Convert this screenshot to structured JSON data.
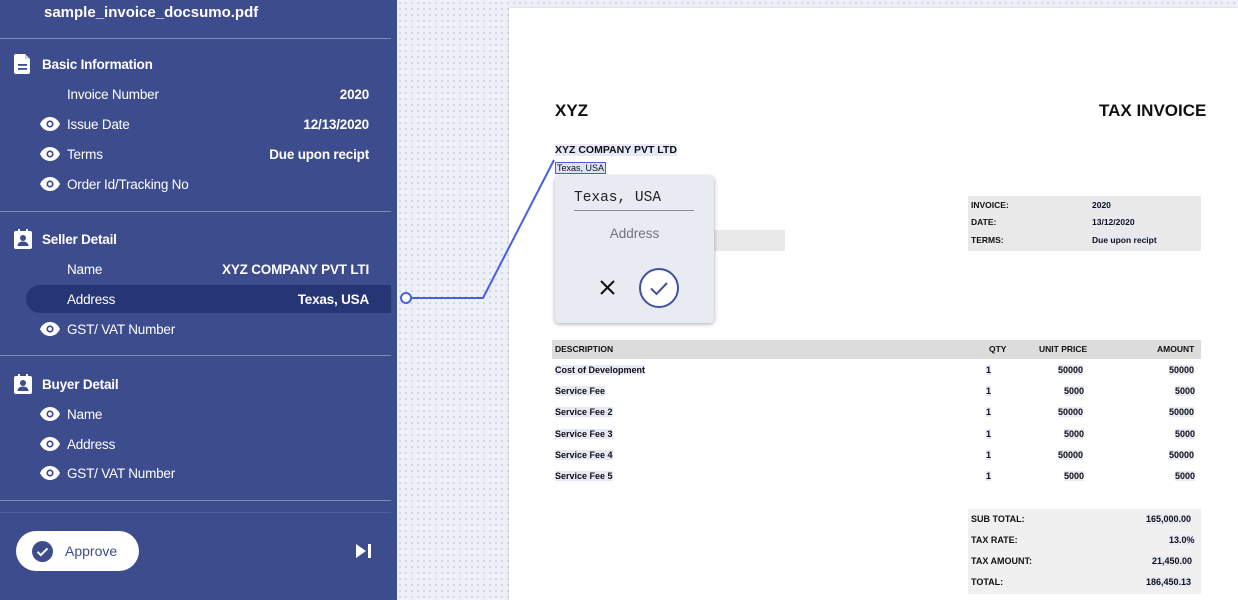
{
  "sidebar": {
    "file_name": "sample_invoice_docsumo.pdf",
    "sections": [
      {
        "title": "Basic Information",
        "icon": "document-icon",
        "fields": [
          {
            "label": "Invoice Number",
            "value": "2020",
            "eye": false
          },
          {
            "label": "Issue Date",
            "value": "12/13/2020",
            "eye": true
          },
          {
            "label": "Terms",
            "value": "Due upon recipt",
            "eye": true
          },
          {
            "label": "Order Id/Tracking No",
            "value": "",
            "eye": true
          }
        ]
      },
      {
        "title": "Seller Detail",
        "icon": "contact-icon",
        "fields": [
          {
            "label": "Name",
            "value": "XYZ COMPANY PVT LTI",
            "eye": false
          },
          {
            "label": "Address",
            "value": "Texas, USA",
            "eye": false,
            "active": true
          },
          {
            "label": "GST/ VAT Number",
            "value": "",
            "eye": true
          }
        ]
      },
      {
        "title": "Buyer Detail",
        "icon": "contact-icon",
        "fields": [
          {
            "label": "Name",
            "value": "",
            "eye": true
          },
          {
            "label": "Address",
            "value": "",
            "eye": true
          },
          {
            "label": "GST/ VAT Number",
            "value": "",
            "eye": true
          }
        ]
      }
    ],
    "approve_label": "Approve"
  },
  "popup": {
    "input_value": "Texas, USA",
    "field_name": "Address"
  },
  "document": {
    "company_short": "XYZ",
    "doc_title": "TAX INVOICE",
    "company_name": "XYZ COMPANY PVT LTD",
    "company_address": "Texas, USA",
    "meta": [
      {
        "label": "INVOICE:",
        "value": "2020"
      },
      {
        "label": "DATE:",
        "value": "13/12/2020"
      },
      {
        "label": "TERMS:",
        "value": "Due upon recipt"
      }
    ],
    "table_headers": {
      "description": "DESCRIPTION",
      "qty": "QTY",
      "unit_price": "UNIT PRICE",
      "amount": "AMOUNT"
    },
    "line_items": [
      {
        "description": "Cost of Development",
        "qty": "1",
        "unit_price": "50000",
        "amount": "50000"
      },
      {
        "description": "Service Fee",
        "qty": "1",
        "unit_price": "5000",
        "amount": "5000"
      },
      {
        "description": "Service Fee 2",
        "qty": "1",
        "unit_price": "50000",
        "amount": "50000"
      },
      {
        "description": "Service Fee 3",
        "qty": "1",
        "unit_price": "5000",
        "amount": "5000"
      },
      {
        "description": "Service Fee 4",
        "qty": "1",
        "unit_price": "50000",
        "amount": "50000"
      },
      {
        "description": "Service Fee 5",
        "qty": "1",
        "unit_price": "5000",
        "amount": "5000"
      }
    ],
    "totals": [
      {
        "label": "SUB TOTAL:",
        "value": "165,000.00"
      },
      {
        "label": "TAX RATE:",
        "value": "13.0%"
      },
      {
        "label": "TAX AMOUNT:",
        "value": "21,450.00"
      },
      {
        "label": "TOTAL:",
        "value": "186,450.13"
      }
    ]
  },
  "colors": {
    "sidebar_bg": "#3d4c8c",
    "active_row_bg": "#263574",
    "accent": "#4150a0",
    "connector": "#4a5fe0"
  }
}
